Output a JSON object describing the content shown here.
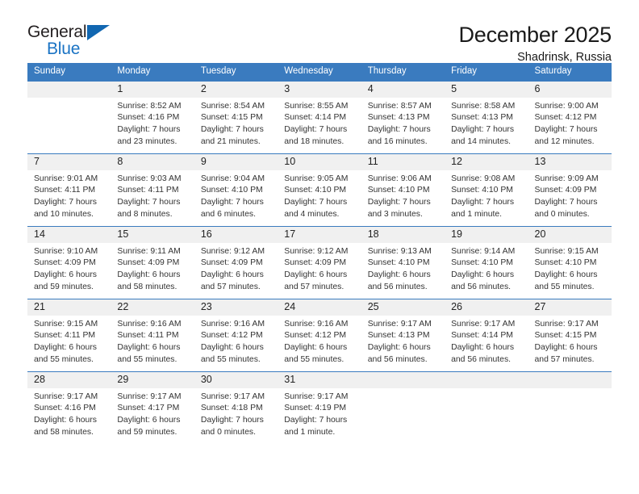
{
  "brand": {
    "name_top": "General",
    "name_bottom": "Blue",
    "accent_color": "#1167b1",
    "text_color": "#231f20"
  },
  "header": {
    "title": "December 2025",
    "subtitle": "Shadrinsk, Russia"
  },
  "calendar": {
    "header_bg": "#3a7bbf",
    "daynum_bg": "#f0f0f0",
    "weekdays": [
      "Sunday",
      "Monday",
      "Tuesday",
      "Wednesday",
      "Thursday",
      "Friday",
      "Saturday"
    ],
    "weeks": [
      [
        {
          "day": "",
          "blank": true
        },
        {
          "day": "1",
          "sunrise": "Sunrise: 8:52 AM",
          "sunset": "Sunset: 4:16 PM",
          "daylight1": "Daylight: 7 hours",
          "daylight2": "and 23 minutes."
        },
        {
          "day": "2",
          "sunrise": "Sunrise: 8:54 AM",
          "sunset": "Sunset: 4:15 PM",
          "daylight1": "Daylight: 7 hours",
          "daylight2": "and 21 minutes."
        },
        {
          "day": "3",
          "sunrise": "Sunrise: 8:55 AM",
          "sunset": "Sunset: 4:14 PM",
          "daylight1": "Daylight: 7 hours",
          "daylight2": "and 18 minutes."
        },
        {
          "day": "4",
          "sunrise": "Sunrise: 8:57 AM",
          "sunset": "Sunset: 4:13 PM",
          "daylight1": "Daylight: 7 hours",
          "daylight2": "and 16 minutes."
        },
        {
          "day": "5",
          "sunrise": "Sunrise: 8:58 AM",
          "sunset": "Sunset: 4:13 PM",
          "daylight1": "Daylight: 7 hours",
          "daylight2": "and 14 minutes."
        },
        {
          "day": "6",
          "sunrise": "Sunrise: 9:00 AM",
          "sunset": "Sunset: 4:12 PM",
          "daylight1": "Daylight: 7 hours",
          "daylight2": "and 12 minutes."
        }
      ],
      [
        {
          "day": "7",
          "sunrise": "Sunrise: 9:01 AM",
          "sunset": "Sunset: 4:11 PM",
          "daylight1": "Daylight: 7 hours",
          "daylight2": "and 10 minutes."
        },
        {
          "day": "8",
          "sunrise": "Sunrise: 9:03 AM",
          "sunset": "Sunset: 4:11 PM",
          "daylight1": "Daylight: 7 hours",
          "daylight2": "and 8 minutes."
        },
        {
          "day": "9",
          "sunrise": "Sunrise: 9:04 AM",
          "sunset": "Sunset: 4:10 PM",
          "daylight1": "Daylight: 7 hours",
          "daylight2": "and 6 minutes."
        },
        {
          "day": "10",
          "sunrise": "Sunrise: 9:05 AM",
          "sunset": "Sunset: 4:10 PM",
          "daylight1": "Daylight: 7 hours",
          "daylight2": "and 4 minutes."
        },
        {
          "day": "11",
          "sunrise": "Sunrise: 9:06 AM",
          "sunset": "Sunset: 4:10 PM",
          "daylight1": "Daylight: 7 hours",
          "daylight2": "and 3 minutes."
        },
        {
          "day": "12",
          "sunrise": "Sunrise: 9:08 AM",
          "sunset": "Sunset: 4:10 PM",
          "daylight1": "Daylight: 7 hours",
          "daylight2": "and 1 minute."
        },
        {
          "day": "13",
          "sunrise": "Sunrise: 9:09 AM",
          "sunset": "Sunset: 4:09 PM",
          "daylight1": "Daylight: 7 hours",
          "daylight2": "and 0 minutes."
        }
      ],
      [
        {
          "day": "14",
          "sunrise": "Sunrise: 9:10 AM",
          "sunset": "Sunset: 4:09 PM",
          "daylight1": "Daylight: 6 hours",
          "daylight2": "and 59 minutes."
        },
        {
          "day": "15",
          "sunrise": "Sunrise: 9:11 AM",
          "sunset": "Sunset: 4:09 PM",
          "daylight1": "Daylight: 6 hours",
          "daylight2": "and 58 minutes."
        },
        {
          "day": "16",
          "sunrise": "Sunrise: 9:12 AM",
          "sunset": "Sunset: 4:09 PM",
          "daylight1": "Daylight: 6 hours",
          "daylight2": "and 57 minutes."
        },
        {
          "day": "17",
          "sunrise": "Sunrise: 9:12 AM",
          "sunset": "Sunset: 4:09 PM",
          "daylight1": "Daylight: 6 hours",
          "daylight2": "and 57 minutes."
        },
        {
          "day": "18",
          "sunrise": "Sunrise: 9:13 AM",
          "sunset": "Sunset: 4:10 PM",
          "daylight1": "Daylight: 6 hours",
          "daylight2": "and 56 minutes."
        },
        {
          "day": "19",
          "sunrise": "Sunrise: 9:14 AM",
          "sunset": "Sunset: 4:10 PM",
          "daylight1": "Daylight: 6 hours",
          "daylight2": "and 56 minutes."
        },
        {
          "day": "20",
          "sunrise": "Sunrise: 9:15 AM",
          "sunset": "Sunset: 4:10 PM",
          "daylight1": "Daylight: 6 hours",
          "daylight2": "and 55 minutes."
        }
      ],
      [
        {
          "day": "21",
          "sunrise": "Sunrise: 9:15 AM",
          "sunset": "Sunset: 4:11 PM",
          "daylight1": "Daylight: 6 hours",
          "daylight2": "and 55 minutes."
        },
        {
          "day": "22",
          "sunrise": "Sunrise: 9:16 AM",
          "sunset": "Sunset: 4:11 PM",
          "daylight1": "Daylight: 6 hours",
          "daylight2": "and 55 minutes."
        },
        {
          "day": "23",
          "sunrise": "Sunrise: 9:16 AM",
          "sunset": "Sunset: 4:12 PM",
          "daylight1": "Daylight: 6 hours",
          "daylight2": "and 55 minutes."
        },
        {
          "day": "24",
          "sunrise": "Sunrise: 9:16 AM",
          "sunset": "Sunset: 4:12 PM",
          "daylight1": "Daylight: 6 hours",
          "daylight2": "and 55 minutes."
        },
        {
          "day": "25",
          "sunrise": "Sunrise: 9:17 AM",
          "sunset": "Sunset: 4:13 PM",
          "daylight1": "Daylight: 6 hours",
          "daylight2": "and 56 minutes."
        },
        {
          "day": "26",
          "sunrise": "Sunrise: 9:17 AM",
          "sunset": "Sunset: 4:14 PM",
          "daylight1": "Daylight: 6 hours",
          "daylight2": "and 56 minutes."
        },
        {
          "day": "27",
          "sunrise": "Sunrise: 9:17 AM",
          "sunset": "Sunset: 4:15 PM",
          "daylight1": "Daylight: 6 hours",
          "daylight2": "and 57 minutes."
        }
      ],
      [
        {
          "day": "28",
          "sunrise": "Sunrise: 9:17 AM",
          "sunset": "Sunset: 4:16 PM",
          "daylight1": "Daylight: 6 hours",
          "daylight2": "and 58 minutes."
        },
        {
          "day": "29",
          "sunrise": "Sunrise: 9:17 AM",
          "sunset": "Sunset: 4:17 PM",
          "daylight1": "Daylight: 6 hours",
          "daylight2": "and 59 minutes."
        },
        {
          "day": "30",
          "sunrise": "Sunrise: 9:17 AM",
          "sunset": "Sunset: 4:18 PM",
          "daylight1": "Daylight: 7 hours",
          "daylight2": "and 0 minutes."
        },
        {
          "day": "31",
          "sunrise": "Sunrise: 9:17 AM",
          "sunset": "Sunset: 4:19 PM",
          "daylight1": "Daylight: 7 hours",
          "daylight2": "and 1 minute."
        },
        {
          "day": "",
          "blank": true
        },
        {
          "day": "",
          "blank": true
        },
        {
          "day": "",
          "blank": true
        }
      ]
    ]
  }
}
